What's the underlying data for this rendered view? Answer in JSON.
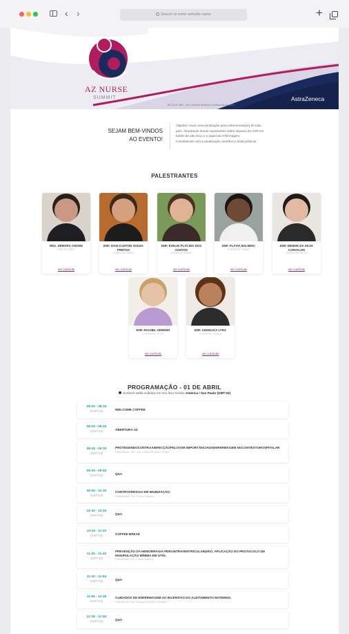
{
  "browser": {
    "address_placeholder": "Search or enter website name",
    "back_glyph": "‹",
    "forward_glyph": "›",
    "new_tab_glyph": "+"
  },
  "banner": {
    "title": "AZ NURSE",
    "subtitle": "SUMMIT",
    "note": "BR-22116. MAR - 2021 | Material destinado a profissionais da saúde.",
    "sponsor": "AstraZeneca",
    "colors": {
      "magenta": "#b01c5e",
      "navy": "#1b2a5c",
      "lavender": "#dad5e6"
    }
  },
  "welcome": {
    "title_line1": "SEJAM BEM-VINDOS",
    "title_line2": "AO EVENTO!",
    "text_line1": "Objetivo: levar conscientização para enfermeiros(as) de todo",
    "text_line2": "país. Abordando temas importantes sobre impacto do VSR em",
    "text_line3": "bebês de alto risco e o papel da enfermagem.",
    "text_line4": "Contribuindo com a atualização científica e boas práticas."
  },
  "speakers_section": {
    "title": "PALESTRANTES",
    "link_label": "ver currículo"
  },
  "speakers": [
    {
      "name": "DRA. DÉBORA CHONG",
      "reg": "CRM-SP. 55647"
    },
    {
      "name": "ENF. IVAN CLEITON SOUZA FREITAS",
      "reg": "COREN-SP 335687"
    },
    {
      "name": "ENF. EVELIN PLÁCIDO DOS SANTOS",
      "reg": "COREN-SP. 569882"
    },
    {
      "name": "ENF. FLÁVIA BALBINO",
      "reg": "COREN-SP. 564421"
    },
    {
      "name": "ENF. DENISE DA SILVA CARVALHO",
      "reg": "COREN-SP. 96774"
    },
    {
      "name": "ENF. RACHEL SERENO",
      "reg": "COREN-RJ. 96770"
    },
    {
      "name": "ENF. ANGELICA LYRA",
      "reg": "COREN-RJ. 234445"
    }
  ],
  "schedule": {
    "title": "PROGRAMAÇÃO - 01 DE ABRIL",
    "tz_prefix": "Horários estão exibidos em seu fuso horário",
    "tz_value": "America / Sao Paulo (GMT-03)",
    "zone": "(GMT-03)",
    "items": [
      {
        "time": "08:00 - 08:30",
        "title": "WELCOME COFFEE",
        "speaker": ""
      },
      {
        "time": "08:30 - 08:45",
        "title": "ABERTURA AZ",
        "speaker": ""
      },
      {
        "time": "08:45 - 09:30",
        "title": "PROTEGENDOCONTRAAINFECÇÃOPELOVSR:IMPORTÂNCIADAENFERMAGEM NOCONTEXTOHOSPITALAR",
        "speaker": "Palestrante: Enf. Ivan Cleiton Souza Freitas"
      },
      {
        "time": "09:30 - 09:50",
        "title": "Q&A",
        "speaker": ""
      },
      {
        "time": "09:50 - 10:30",
        "title": "CONTROVÉRSIAS EM IMUNIZAÇÃO.",
        "speaker": "Palestrante: Enf. Evelin Plácido"
      },
      {
        "time": "10:30 - 10:45",
        "title": "Q&A",
        "speaker": ""
      },
      {
        "time": "10:45 - 11:00",
        "title": "COFFEE BREAK",
        "speaker": ""
      },
      {
        "time": "11:00 - 11:40",
        "title": "PREVENÇÃO DA HEMORRAGIA PERI-INTRAVENTRICULAR(HIV): APLICAÇÃO DO PROTOCOLO DE MANIPULAÇÃO MÍNIMA EM UTIN.",
        "speaker": "Palestrante: Enf. Flávia Balbino"
      },
      {
        "time": "11:40 - 11:55",
        "title": "Q&A",
        "speaker": ""
      },
      {
        "time": "11:55 - 12:35",
        "title": "CUIDADOS DE ENFERMAGEM AO INCENTIVO DO ALEITAMENTO MATERNO.",
        "speaker": "Palestrante: Enf. Denise da Silva Carvalho"
      },
      {
        "time": "12:35 - 12:50",
        "title": "Q&A",
        "speaker": ""
      }
    ]
  }
}
